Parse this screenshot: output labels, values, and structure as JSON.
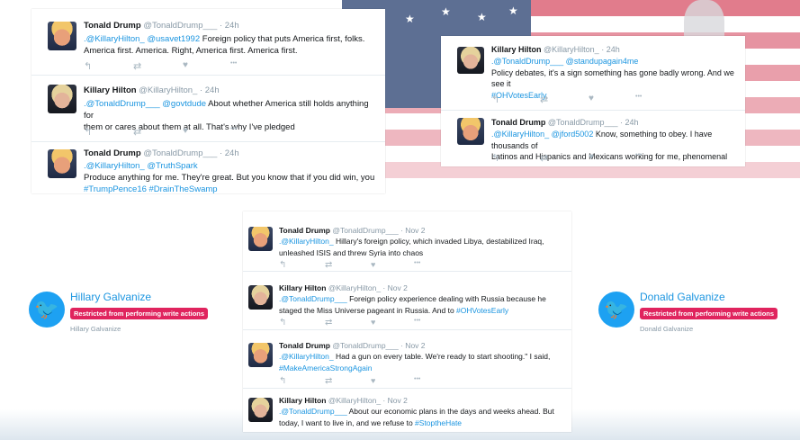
{
  "colors": {
    "link": "#1b95e0",
    "badge": "#e0245e",
    "bird": "#1da1f2",
    "muted": "#8899a6",
    "flag_red": "#c8102e",
    "flag_blue": "#5d6f93"
  },
  "icons": {
    "reply": "↰",
    "retweet": "⇄",
    "like": "♥",
    "more": "•••",
    "bird": "🐦"
  },
  "card_top_left": {
    "tweets": [
      {
        "name": "Tonald Drump",
        "handle": "@TonaldDrump___",
        "time": "· 24h",
        "line1": {
          "mention": ".@KillaryHilton_ @usavet1992",
          "text": " Foreign policy that puts America first, folks."
        },
        "line2": {
          "text": "America first. America. Right, America first. America first."
        }
      },
      {
        "name": "Killary Hilton",
        "handle": "@KillaryHilton_",
        "time": "· 24h",
        "line1": {
          "mention": ".@TonaldDrump___ @govtdude",
          "text": " About whether America still holds anything for"
        },
        "line2": {
          "text": "them or cares about them at all. That's why I've pledged"
        }
      },
      {
        "name": "Tonald Drump",
        "handle": "@TonaldDrump___",
        "time": "· 24h",
        "line1": {
          "mention": ".@KillaryHilton_ @TruthSpark",
          "text": ""
        },
        "line2": {
          "text": " Produce anything for me. They're great. But you know that if you did win, you"
        },
        "line3": {
          "hashtags": "#TrumpPence16 #DrainTheSwamp"
        }
      }
    ]
  },
  "card_top_right": {
    "tweets": [
      {
        "name": "Killary Hilton",
        "handle": "@KillaryHilton_",
        "time": "· 24h",
        "line1": {
          "mention": ".@TonaldDrump___ @standupagain4me"
        },
        "line2": {
          "text": " Policy debates, it's a sign something has gone badly wrong. And we see it"
        },
        "line3": {
          "hashtags": "#OHVotesEarly"
        }
      },
      {
        "name": "Tonald Drump",
        "handle": "@TonaldDrump___",
        "time": "· 24h",
        "line1": {
          "mention": ".@KillaryHilton_ @jford5002",
          "text": " Know, something to obey. I have thousands of"
        },
        "line2": {
          "text": "Latinos and Hispanics and Mexicans working for me, phenomenal"
        }
      }
    ]
  },
  "card_center": {
    "tweets": [
      {
        "name": "Tonald Drump",
        "handle": "@TonaldDrump___",
        "time": "· Nov 2",
        "line1": {
          "mention": ".@KillaryHilton_",
          "text": " Hillary's foreign policy, which invaded Libya, destabilized Iraq,"
        },
        "line2": {
          "text": "unleashed ISIS and threw Syria into chaos"
        }
      },
      {
        "name": "Killary Hilton",
        "handle": "@KillaryHilton_",
        "time": "· Nov 2",
        "line1": {
          "mention": ".@TonaldDrump___",
          "text": " Foreign policy experience dealing with Russia because he"
        },
        "line2": {
          "text": "staged the Miss Universe pageant in Russia. And to ",
          "hashtags": "#OHVotesEarly"
        }
      },
      {
        "name": "Tonald Drump",
        "handle": "@TonaldDrump___",
        "time": "· Nov 2",
        "line1": {
          "mention": ".@KillaryHilton_",
          "text": " Had a gun on every table. We're ready to start shooting.\" I said,"
        },
        "line2": {
          "hashtags": "#MakeAmericaStrongAgain"
        }
      },
      {
        "name": "Killary Hilton",
        "handle": "@KillaryHilton_",
        "time": "· Nov 2",
        "line1": {
          "mention": ".@TonaldDrump___",
          "text": " About our economic plans in the days and weeks ahead. But"
        },
        "line2": {
          "text": "today, I want to live in, and we refuse to ",
          "hashtags": "#StoptheHate"
        }
      }
    ]
  },
  "profile_left": {
    "name": "Hillary Galvanize",
    "badge": "Restricted from performing write actions",
    "sub": "Hillary Galvanize"
  },
  "profile_right": {
    "name": "Donald Galvanize",
    "badge": "Restricted from performing write actions",
    "sub": "Donald Galvanize"
  }
}
